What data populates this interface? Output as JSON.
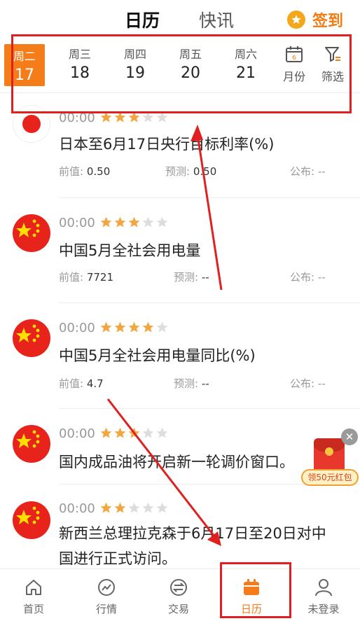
{
  "header": {
    "tabs": [
      "日历",
      "快讯"
    ],
    "signin_label": "签到"
  },
  "dates": [
    {
      "weekday": "周二",
      "day": "17",
      "selected": true
    },
    {
      "weekday": "周三",
      "day": "18"
    },
    {
      "weekday": "周四",
      "day": "19"
    },
    {
      "weekday": "周五",
      "day": "20"
    },
    {
      "weekday": "周六",
      "day": "21"
    }
  ],
  "tools": {
    "month_label": "月份",
    "month_icon_day": "6",
    "filter_label": "筛选"
  },
  "events": [
    {
      "flag": "japan-flag",
      "time": "00:00",
      "stars": 3,
      "title": "日本至6月17日央行目标利率(%)",
      "prev_label": "前值:",
      "prev": "0.50",
      "forecast_label": "预测:",
      "forecast": "0.50",
      "publish_label": "公布:",
      "publish": "--"
    },
    {
      "flag": "china-flag",
      "time": "00:00",
      "stars": 3,
      "title": "中国5月全社会用电量",
      "prev_label": "前值:",
      "prev": "7721",
      "forecast_label": "预测:",
      "forecast": "--",
      "publish_label": "公布:",
      "publish": "--"
    },
    {
      "flag": "china-flag",
      "time": "00:00",
      "stars": 4,
      "title": "中国5月全社会用电量同比(%)",
      "prev_label": "前值:",
      "prev": "4.7",
      "forecast_label": "预测:",
      "forecast": "--",
      "publish_label": "公布:",
      "publish": "--"
    },
    {
      "flag": "china-flag",
      "time": "00:00",
      "stars": 3,
      "title": "国内成品油将开启新一轮调价窗口。"
    },
    {
      "flag": "china-flag",
      "time": "00:00",
      "stars": 2,
      "title_line1": "新西兰总理拉克森于6月17日至20日对中",
      "title_line2": "国进行正式访问。"
    }
  ],
  "red_packet": {
    "label": "领50元红包"
  },
  "bottom_nav": [
    {
      "label": "首页",
      "icon": "home-icon"
    },
    {
      "label": "行情",
      "icon": "market-icon"
    },
    {
      "label": "交易",
      "icon": "trade-icon"
    },
    {
      "label": "日历",
      "icon": "calendar-icon",
      "active": true
    },
    {
      "label": "未登录",
      "icon": "user-icon"
    }
  ],
  "colors": {
    "accent": "#f47c19",
    "highlight": "#e02020",
    "star_on": "#f3a640",
    "star_off": "#dddddd"
  }
}
